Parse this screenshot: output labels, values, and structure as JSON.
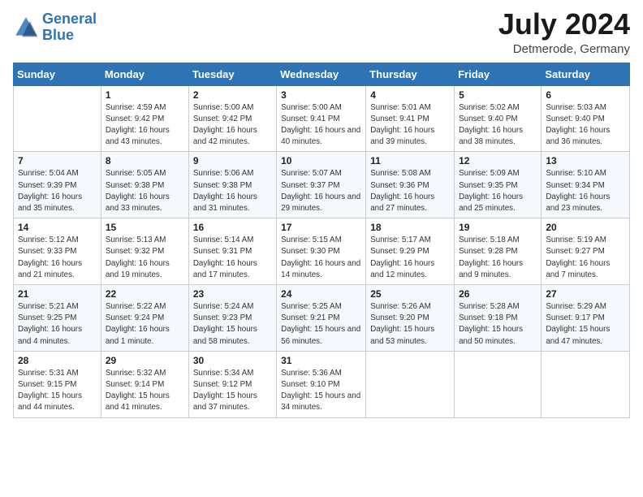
{
  "header": {
    "logo_line1": "General",
    "logo_line2": "Blue",
    "month": "July 2024",
    "location": "Detmerode, Germany"
  },
  "days_of_week": [
    "Sunday",
    "Monday",
    "Tuesday",
    "Wednesday",
    "Thursday",
    "Friday",
    "Saturday"
  ],
  "weeks": [
    [
      {
        "day": "",
        "sunrise": "",
        "sunset": "",
        "daylight": ""
      },
      {
        "day": "1",
        "sunrise": "Sunrise: 4:59 AM",
        "sunset": "Sunset: 9:42 PM",
        "daylight": "Daylight: 16 hours and 43 minutes."
      },
      {
        "day": "2",
        "sunrise": "Sunrise: 5:00 AM",
        "sunset": "Sunset: 9:42 PM",
        "daylight": "Daylight: 16 hours and 42 minutes."
      },
      {
        "day": "3",
        "sunrise": "Sunrise: 5:00 AM",
        "sunset": "Sunset: 9:41 PM",
        "daylight": "Daylight: 16 hours and 40 minutes."
      },
      {
        "day": "4",
        "sunrise": "Sunrise: 5:01 AM",
        "sunset": "Sunset: 9:41 PM",
        "daylight": "Daylight: 16 hours and 39 minutes."
      },
      {
        "day": "5",
        "sunrise": "Sunrise: 5:02 AM",
        "sunset": "Sunset: 9:40 PM",
        "daylight": "Daylight: 16 hours and 38 minutes."
      },
      {
        "day": "6",
        "sunrise": "Sunrise: 5:03 AM",
        "sunset": "Sunset: 9:40 PM",
        "daylight": "Daylight: 16 hours and 36 minutes."
      }
    ],
    [
      {
        "day": "7",
        "sunrise": "Sunrise: 5:04 AM",
        "sunset": "Sunset: 9:39 PM",
        "daylight": "Daylight: 16 hours and 35 minutes."
      },
      {
        "day": "8",
        "sunrise": "Sunrise: 5:05 AM",
        "sunset": "Sunset: 9:38 PM",
        "daylight": "Daylight: 16 hours and 33 minutes."
      },
      {
        "day": "9",
        "sunrise": "Sunrise: 5:06 AM",
        "sunset": "Sunset: 9:38 PM",
        "daylight": "Daylight: 16 hours and 31 minutes."
      },
      {
        "day": "10",
        "sunrise": "Sunrise: 5:07 AM",
        "sunset": "Sunset: 9:37 PM",
        "daylight": "Daylight: 16 hours and 29 minutes."
      },
      {
        "day": "11",
        "sunrise": "Sunrise: 5:08 AM",
        "sunset": "Sunset: 9:36 PM",
        "daylight": "Daylight: 16 hours and 27 minutes."
      },
      {
        "day": "12",
        "sunrise": "Sunrise: 5:09 AM",
        "sunset": "Sunset: 9:35 PM",
        "daylight": "Daylight: 16 hours and 25 minutes."
      },
      {
        "day": "13",
        "sunrise": "Sunrise: 5:10 AM",
        "sunset": "Sunset: 9:34 PM",
        "daylight": "Daylight: 16 hours and 23 minutes."
      }
    ],
    [
      {
        "day": "14",
        "sunrise": "Sunrise: 5:12 AM",
        "sunset": "Sunset: 9:33 PM",
        "daylight": "Daylight: 16 hours and 21 minutes."
      },
      {
        "day": "15",
        "sunrise": "Sunrise: 5:13 AM",
        "sunset": "Sunset: 9:32 PM",
        "daylight": "Daylight: 16 hours and 19 minutes."
      },
      {
        "day": "16",
        "sunrise": "Sunrise: 5:14 AM",
        "sunset": "Sunset: 9:31 PM",
        "daylight": "Daylight: 16 hours and 17 minutes."
      },
      {
        "day": "17",
        "sunrise": "Sunrise: 5:15 AM",
        "sunset": "Sunset: 9:30 PM",
        "daylight": "Daylight: 16 hours and 14 minutes."
      },
      {
        "day": "18",
        "sunrise": "Sunrise: 5:17 AM",
        "sunset": "Sunset: 9:29 PM",
        "daylight": "Daylight: 16 hours and 12 minutes."
      },
      {
        "day": "19",
        "sunrise": "Sunrise: 5:18 AM",
        "sunset": "Sunset: 9:28 PM",
        "daylight": "Daylight: 16 hours and 9 minutes."
      },
      {
        "day": "20",
        "sunrise": "Sunrise: 5:19 AM",
        "sunset": "Sunset: 9:27 PM",
        "daylight": "Daylight: 16 hours and 7 minutes."
      }
    ],
    [
      {
        "day": "21",
        "sunrise": "Sunrise: 5:21 AM",
        "sunset": "Sunset: 9:25 PM",
        "daylight": "Daylight: 16 hours and 4 minutes."
      },
      {
        "day": "22",
        "sunrise": "Sunrise: 5:22 AM",
        "sunset": "Sunset: 9:24 PM",
        "daylight": "Daylight: 16 hours and 1 minute."
      },
      {
        "day": "23",
        "sunrise": "Sunrise: 5:24 AM",
        "sunset": "Sunset: 9:23 PM",
        "daylight": "Daylight: 15 hours and 58 minutes."
      },
      {
        "day": "24",
        "sunrise": "Sunrise: 5:25 AM",
        "sunset": "Sunset: 9:21 PM",
        "daylight": "Daylight: 15 hours and 56 minutes."
      },
      {
        "day": "25",
        "sunrise": "Sunrise: 5:26 AM",
        "sunset": "Sunset: 9:20 PM",
        "daylight": "Daylight: 15 hours and 53 minutes."
      },
      {
        "day": "26",
        "sunrise": "Sunrise: 5:28 AM",
        "sunset": "Sunset: 9:18 PM",
        "daylight": "Daylight: 15 hours and 50 minutes."
      },
      {
        "day": "27",
        "sunrise": "Sunrise: 5:29 AM",
        "sunset": "Sunset: 9:17 PM",
        "daylight": "Daylight: 15 hours and 47 minutes."
      }
    ],
    [
      {
        "day": "28",
        "sunrise": "Sunrise: 5:31 AM",
        "sunset": "Sunset: 9:15 PM",
        "daylight": "Daylight: 15 hours and 44 minutes."
      },
      {
        "day": "29",
        "sunrise": "Sunrise: 5:32 AM",
        "sunset": "Sunset: 9:14 PM",
        "daylight": "Daylight: 15 hours and 41 minutes."
      },
      {
        "day": "30",
        "sunrise": "Sunrise: 5:34 AM",
        "sunset": "Sunset: 9:12 PM",
        "daylight": "Daylight: 15 hours and 37 minutes."
      },
      {
        "day": "31",
        "sunrise": "Sunrise: 5:36 AM",
        "sunset": "Sunset: 9:10 PM",
        "daylight": "Daylight: 15 hours and 34 minutes."
      },
      {
        "day": "",
        "sunrise": "",
        "sunset": "",
        "daylight": ""
      },
      {
        "day": "",
        "sunrise": "",
        "sunset": "",
        "daylight": ""
      },
      {
        "day": "",
        "sunrise": "",
        "sunset": "",
        "daylight": ""
      }
    ]
  ]
}
